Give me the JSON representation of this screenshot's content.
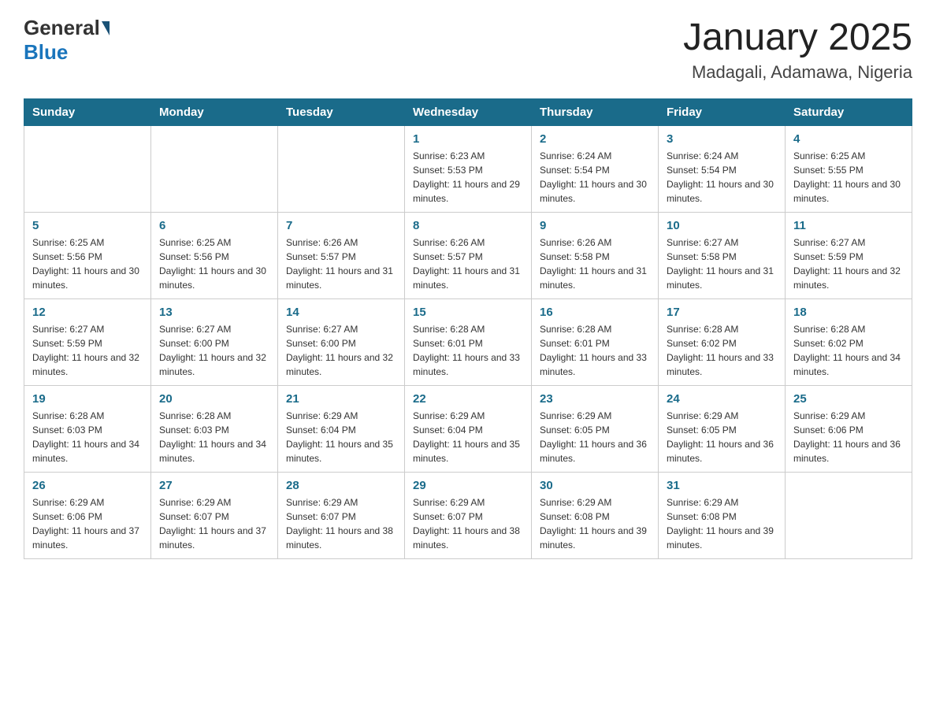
{
  "header": {
    "logo_general": "General",
    "logo_blue": "Blue",
    "month_title": "January 2025",
    "location": "Madagali, Adamawa, Nigeria"
  },
  "columns": [
    "Sunday",
    "Monday",
    "Tuesday",
    "Wednesday",
    "Thursday",
    "Friday",
    "Saturday"
  ],
  "weeks": [
    [
      {
        "day": "",
        "info": ""
      },
      {
        "day": "",
        "info": ""
      },
      {
        "day": "",
        "info": ""
      },
      {
        "day": "1",
        "info": "Sunrise: 6:23 AM\nSunset: 5:53 PM\nDaylight: 11 hours and 29 minutes."
      },
      {
        "day": "2",
        "info": "Sunrise: 6:24 AM\nSunset: 5:54 PM\nDaylight: 11 hours and 30 minutes."
      },
      {
        "day": "3",
        "info": "Sunrise: 6:24 AM\nSunset: 5:54 PM\nDaylight: 11 hours and 30 minutes."
      },
      {
        "day": "4",
        "info": "Sunrise: 6:25 AM\nSunset: 5:55 PM\nDaylight: 11 hours and 30 minutes."
      }
    ],
    [
      {
        "day": "5",
        "info": "Sunrise: 6:25 AM\nSunset: 5:56 PM\nDaylight: 11 hours and 30 minutes."
      },
      {
        "day": "6",
        "info": "Sunrise: 6:25 AM\nSunset: 5:56 PM\nDaylight: 11 hours and 30 minutes."
      },
      {
        "day": "7",
        "info": "Sunrise: 6:26 AM\nSunset: 5:57 PM\nDaylight: 11 hours and 31 minutes."
      },
      {
        "day": "8",
        "info": "Sunrise: 6:26 AM\nSunset: 5:57 PM\nDaylight: 11 hours and 31 minutes."
      },
      {
        "day": "9",
        "info": "Sunrise: 6:26 AM\nSunset: 5:58 PM\nDaylight: 11 hours and 31 minutes."
      },
      {
        "day": "10",
        "info": "Sunrise: 6:27 AM\nSunset: 5:58 PM\nDaylight: 11 hours and 31 minutes."
      },
      {
        "day": "11",
        "info": "Sunrise: 6:27 AM\nSunset: 5:59 PM\nDaylight: 11 hours and 32 minutes."
      }
    ],
    [
      {
        "day": "12",
        "info": "Sunrise: 6:27 AM\nSunset: 5:59 PM\nDaylight: 11 hours and 32 minutes."
      },
      {
        "day": "13",
        "info": "Sunrise: 6:27 AM\nSunset: 6:00 PM\nDaylight: 11 hours and 32 minutes."
      },
      {
        "day": "14",
        "info": "Sunrise: 6:27 AM\nSunset: 6:00 PM\nDaylight: 11 hours and 32 minutes."
      },
      {
        "day": "15",
        "info": "Sunrise: 6:28 AM\nSunset: 6:01 PM\nDaylight: 11 hours and 33 minutes."
      },
      {
        "day": "16",
        "info": "Sunrise: 6:28 AM\nSunset: 6:01 PM\nDaylight: 11 hours and 33 minutes."
      },
      {
        "day": "17",
        "info": "Sunrise: 6:28 AM\nSunset: 6:02 PM\nDaylight: 11 hours and 33 minutes."
      },
      {
        "day": "18",
        "info": "Sunrise: 6:28 AM\nSunset: 6:02 PM\nDaylight: 11 hours and 34 minutes."
      }
    ],
    [
      {
        "day": "19",
        "info": "Sunrise: 6:28 AM\nSunset: 6:03 PM\nDaylight: 11 hours and 34 minutes."
      },
      {
        "day": "20",
        "info": "Sunrise: 6:28 AM\nSunset: 6:03 PM\nDaylight: 11 hours and 34 minutes."
      },
      {
        "day": "21",
        "info": "Sunrise: 6:29 AM\nSunset: 6:04 PM\nDaylight: 11 hours and 35 minutes."
      },
      {
        "day": "22",
        "info": "Sunrise: 6:29 AM\nSunset: 6:04 PM\nDaylight: 11 hours and 35 minutes."
      },
      {
        "day": "23",
        "info": "Sunrise: 6:29 AM\nSunset: 6:05 PM\nDaylight: 11 hours and 36 minutes."
      },
      {
        "day": "24",
        "info": "Sunrise: 6:29 AM\nSunset: 6:05 PM\nDaylight: 11 hours and 36 minutes."
      },
      {
        "day": "25",
        "info": "Sunrise: 6:29 AM\nSunset: 6:06 PM\nDaylight: 11 hours and 36 minutes."
      }
    ],
    [
      {
        "day": "26",
        "info": "Sunrise: 6:29 AM\nSunset: 6:06 PM\nDaylight: 11 hours and 37 minutes."
      },
      {
        "day": "27",
        "info": "Sunrise: 6:29 AM\nSunset: 6:07 PM\nDaylight: 11 hours and 37 minutes."
      },
      {
        "day": "28",
        "info": "Sunrise: 6:29 AM\nSunset: 6:07 PM\nDaylight: 11 hours and 38 minutes."
      },
      {
        "day": "29",
        "info": "Sunrise: 6:29 AM\nSunset: 6:07 PM\nDaylight: 11 hours and 38 minutes."
      },
      {
        "day": "30",
        "info": "Sunrise: 6:29 AM\nSunset: 6:08 PM\nDaylight: 11 hours and 39 minutes."
      },
      {
        "day": "31",
        "info": "Sunrise: 6:29 AM\nSunset: 6:08 PM\nDaylight: 11 hours and 39 minutes."
      },
      {
        "day": "",
        "info": ""
      }
    ]
  ]
}
